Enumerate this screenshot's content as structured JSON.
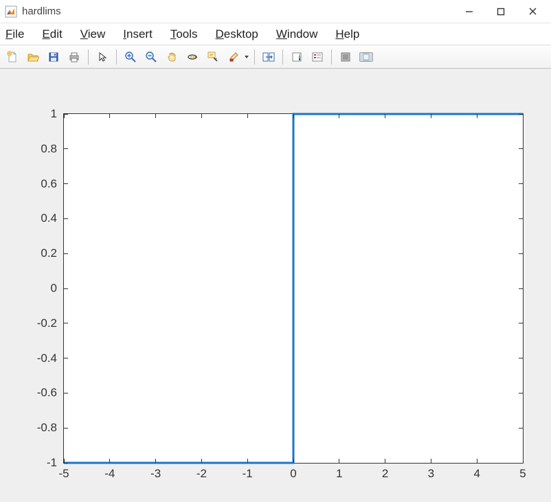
{
  "window": {
    "title": "hardlims"
  },
  "menubar": {
    "file": "File",
    "edit": "Edit",
    "view": "View",
    "insert": "Insert",
    "tools": "Tools",
    "desktop": "Desktop",
    "window": "Window",
    "help": "Help"
  },
  "toolbar": {
    "new": "New",
    "open": "Open",
    "save": "Save",
    "print": "Print",
    "pointer": "Pointer",
    "zoom_in": "Zoom In",
    "zoom_out": "Zoom Out",
    "pan": "Pan",
    "rotate": "Rotate 3D",
    "data_cursor": "Data Cursor",
    "brush": "Brush",
    "link": "Link",
    "colorbar": "Colorbar",
    "legend": "Legend",
    "hide_tools": "Hide Plot Tools",
    "show_tools": "Show Plot Tools"
  },
  "chart_data": {
    "type": "line",
    "x": [
      -5,
      0,
      0,
      5
    ],
    "y": [
      -1,
      -1,
      1,
      1
    ],
    "xlim": [
      -5,
      5
    ],
    "ylim": [
      -1,
      1
    ],
    "xticks": [
      -5,
      -4,
      -3,
      -2,
      -1,
      0,
      1,
      2,
      3,
      4,
      5
    ],
    "yticks": [
      -1,
      -0.8,
      -0.6,
      -0.4,
      -0.2,
      0,
      0.2,
      0.4,
      0.6,
      0.8,
      1
    ],
    "line_color": "#1976c9",
    "line_width": 3
  }
}
